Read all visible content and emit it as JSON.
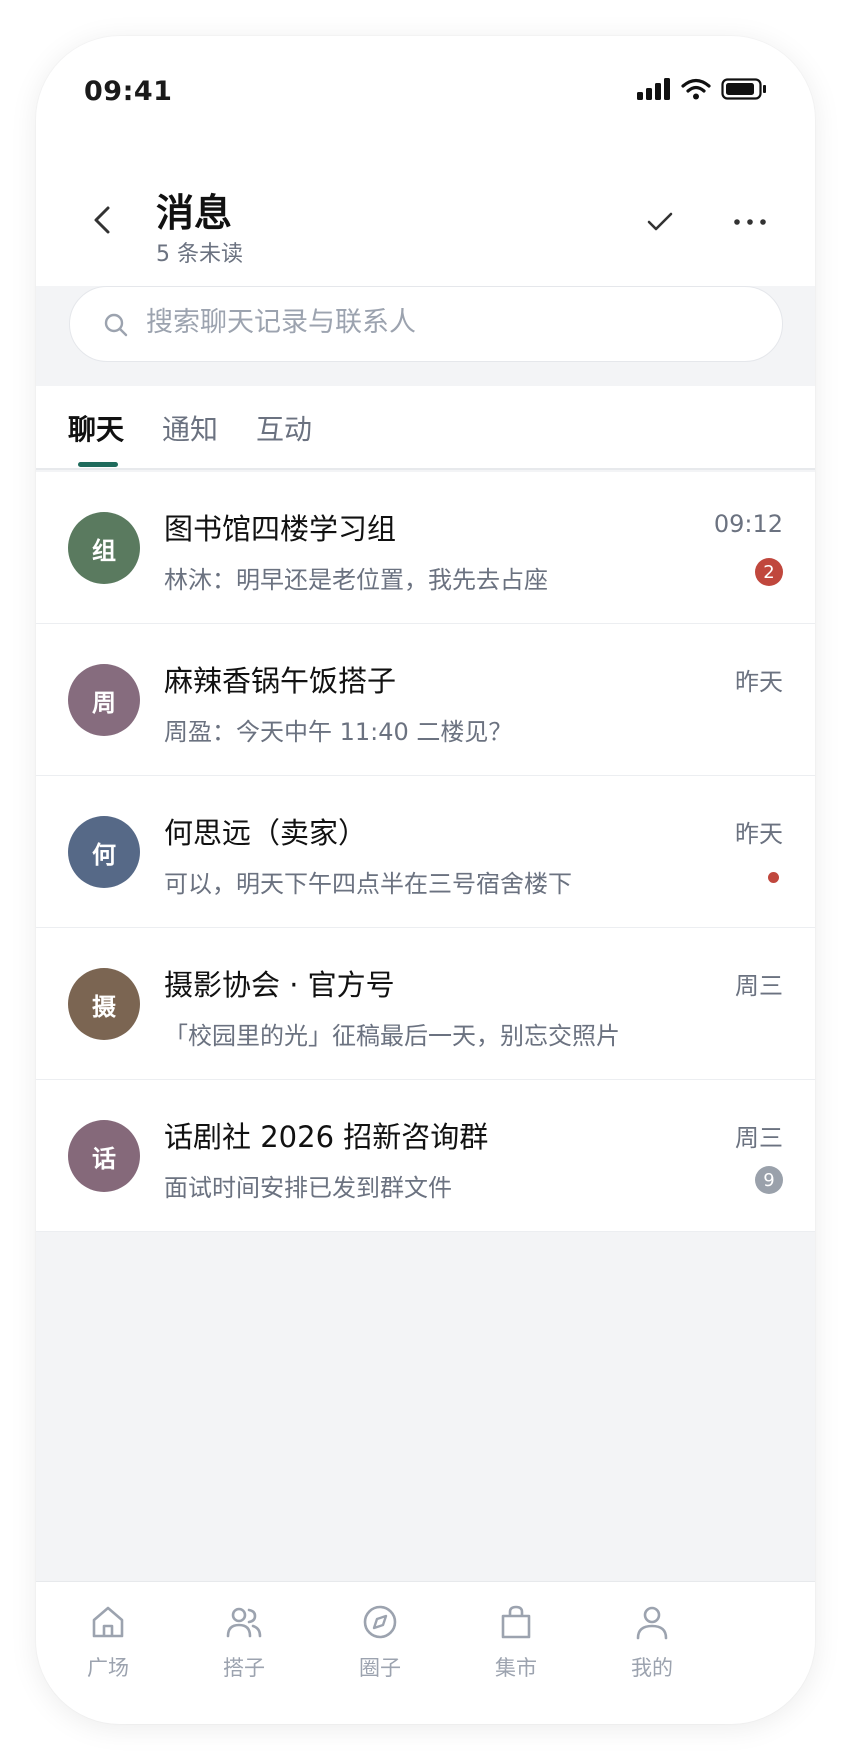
{
  "status_bar": {
    "time": "09:41"
  },
  "header": {
    "title": "消息",
    "subtitle": "5 条未读"
  },
  "search": {
    "placeholder": "搜索聊天记录与联系人"
  },
  "tabs": [
    {
      "label": "聊天",
      "active": true
    },
    {
      "label": "通知",
      "active": false
    },
    {
      "label": "互动",
      "active": false
    }
  ],
  "chats": [
    {
      "avatar_text": "组",
      "avatar_color": "#5a7a5f",
      "name": "图书馆四楼学习组",
      "time": "09:12",
      "preview": "林沐：明早还是老位置，我先去占座",
      "badge": "2",
      "badge_color": "#c0473d"
    },
    {
      "avatar_text": "周",
      "avatar_color": "#866c7e",
      "name": "麻辣香锅午饭搭子",
      "time": "昨天",
      "preview": "周盈：今天中午 11:40 二楼见？"
    },
    {
      "avatar_text": "何",
      "avatar_color": "#566987",
      "name": "何思远（卖家）",
      "time": "昨天",
      "preview": "可以，明天下午四点半在三号宿舍楼下",
      "dot_color": "#c0473d"
    },
    {
      "avatar_text": "摄",
      "avatar_color": "#7b6552",
      "name": "摄影协会 · 官方号",
      "time": "周三",
      "preview": "「校园里的光」征稿最后一天，别忘交照片"
    },
    {
      "avatar_text": "话",
      "avatar_color": "#85697a",
      "name": "话剧社 2026 招新咨询群",
      "time": "周三",
      "preview": "面试时间安排已发到群文件",
      "badge": "9",
      "badge_color": "#9aa1ab"
    }
  ],
  "bottom_nav": [
    {
      "label": "广场",
      "icon": "home-icon"
    },
    {
      "label": "搭子",
      "icon": "users-icon"
    },
    {
      "label": "圈子",
      "icon": "compass-icon"
    },
    {
      "label": "集市",
      "icon": "bag-icon"
    },
    {
      "label": "我的",
      "icon": "user-icon"
    }
  ],
  "colors": {
    "accent": "#1f6b5c",
    "unread": "#c0473d",
    "muted_badge": "#9aa1ab",
    "background": "#f3f4f6"
  }
}
